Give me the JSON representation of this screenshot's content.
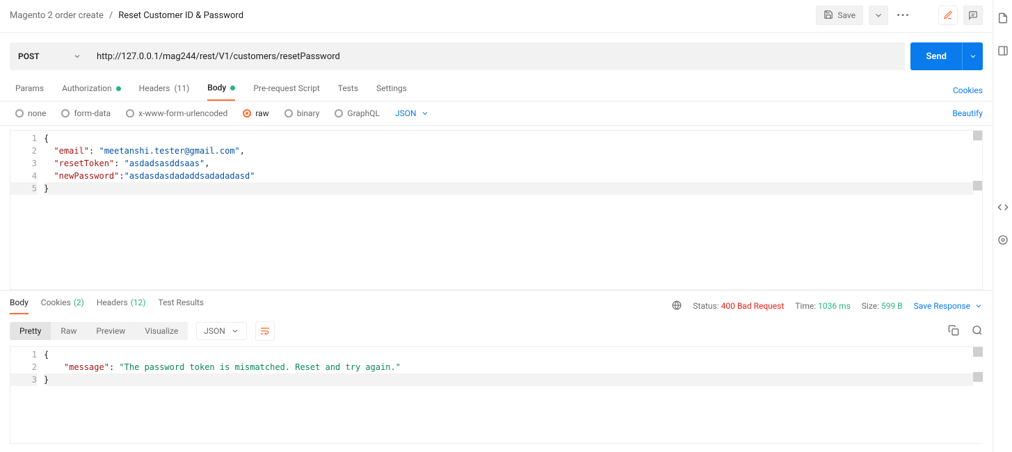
{
  "breadcrumb": {
    "parent": "Magento 2 order create",
    "sep": "/",
    "current": "Reset Customer ID & Password"
  },
  "header": {
    "save_label": "Save"
  },
  "request": {
    "method": "POST",
    "url": "http://127.0.0.1/mag244/rest/V1/customers/resetPassword",
    "send_label": "Send"
  },
  "tabs": {
    "params": "Params",
    "auth": "Authorization",
    "headers": "Headers",
    "headers_count": "(11)",
    "body": "Body",
    "prereq": "Pre-request Script",
    "tests": "Tests",
    "settings": "Settings",
    "cookies": "Cookies"
  },
  "body_types": {
    "none": "none",
    "form_data": "form-data",
    "xwww": "x-www-form-urlencoded",
    "raw": "raw",
    "binary": "binary",
    "graphql": "GraphQL",
    "lang": "JSON",
    "beautify": "Beautify"
  },
  "request_body": {
    "lines": [
      "1",
      "2",
      "3",
      "4",
      "5"
    ],
    "code": {
      "l1": "{",
      "l2_k": "\"email\"",
      "l2_sep": ": ",
      "l2_v": "\"meetanshi.tester@gmail.com\"",
      "l2_t": ",",
      "l3_k": "\"resetToken\"",
      "l3_sep": ": ",
      "l3_v": "\"asdadsasddsaas\"",
      "l3_t": ",",
      "l4_k": "\"newPassword\"",
      "l4_sep": ":",
      "l4_v": "\"asdasdasdadaddsadadadasd\"",
      "l5": "}"
    }
  },
  "response": {
    "tabs": {
      "body": "Body",
      "cookies": "Cookies",
      "cookies_cnt": "(2)",
      "headers": "Headers",
      "headers_cnt": "(12)",
      "tests": "Test Results"
    },
    "status_label": "Status:",
    "status_value": "400 Bad Request",
    "time_label": "Time:",
    "time_value": "1036 ms",
    "size_label": "Size:",
    "size_value": "599 B",
    "save_label": "Save Response"
  },
  "resp_toolbar": {
    "pretty": "Pretty",
    "raw": "Raw",
    "preview": "Preview",
    "visualize": "Visualize",
    "fmt": "JSON"
  },
  "response_body": {
    "lines": [
      "1",
      "2",
      "3"
    ],
    "code": {
      "l1": "{",
      "l2_k": "\"message\"",
      "l2_sep": ": ",
      "l2_v": "\"The password token is mismatched. Reset and try again.\"",
      "l3": "}"
    }
  }
}
